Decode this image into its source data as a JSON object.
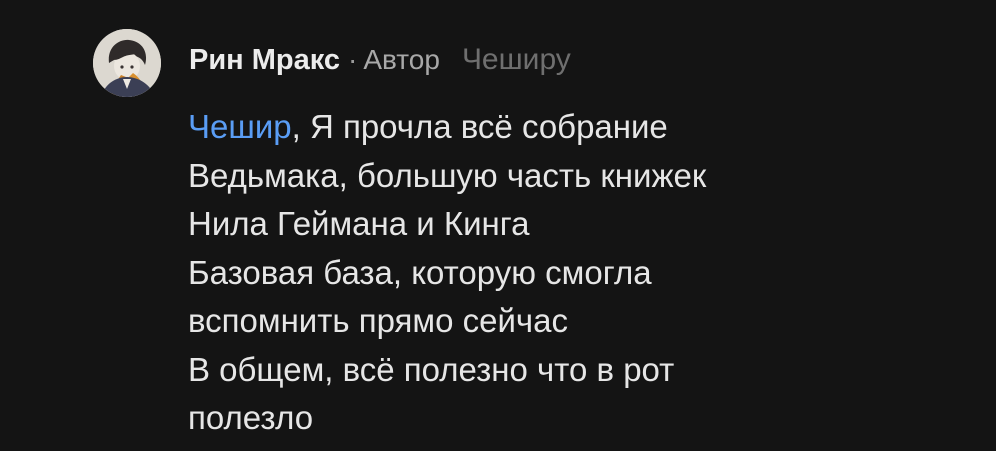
{
  "comment": {
    "author_name": "Рин Мракс",
    "separator": "·",
    "author_badge": "Автор",
    "reply_to": "Чеширу",
    "avatar_icon": "user-avatar-icon",
    "mention": "Чешир",
    "first_line_rest": ", Я прочла всё собрание",
    "lines": [
      "Ведьмака, большую часть книжек",
      "Нила Геймана и Кинга",
      "Базовая база, которую смогла",
      "вспомнить прямо сейчас",
      "В общем, всё полезно что в рот",
      "полезло"
    ],
    "colors": {
      "background": "#141414",
      "text": "#e6e6e6",
      "mention": "#5a9df5",
      "muted": "#a8a8a8",
      "reply_to": "#6f6f6f"
    }
  }
}
